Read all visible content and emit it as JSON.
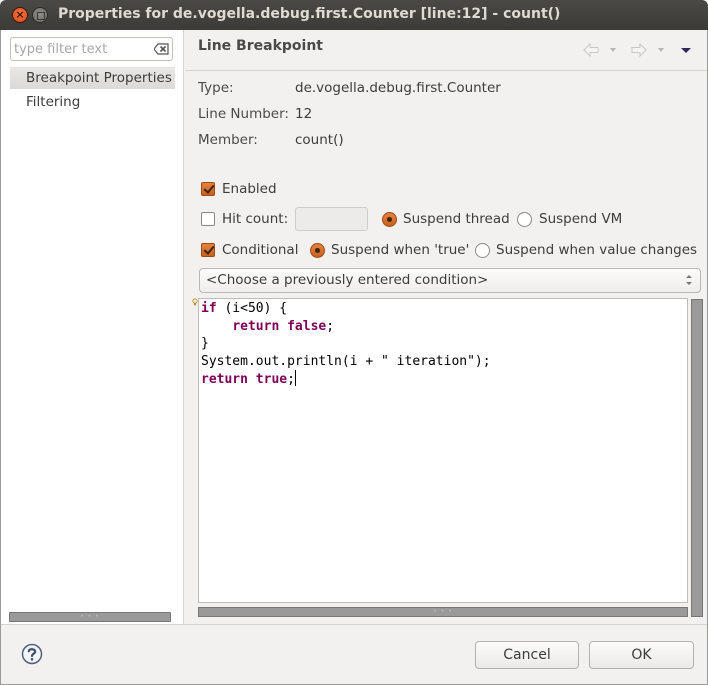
{
  "window": {
    "title": "Properties for de.vogella.debug.first.Counter [line:12] - count()"
  },
  "sidebar": {
    "filter_placeholder": "type filter text",
    "items": [
      {
        "label": "Breakpoint Properties",
        "selected": true
      },
      {
        "label": "Filtering",
        "selected": false
      }
    ]
  },
  "page": {
    "title": "Line Breakpoint",
    "nav": [
      "back-icon",
      "back-menu-icon",
      "forward-icon",
      "forward-menu-icon",
      "view-menu-icon"
    ],
    "properties": [
      {
        "label": "Type:",
        "value": "de.vogella.debug.first.Counter"
      },
      {
        "label": "Line Number:",
        "value": "12"
      },
      {
        "label": "Member:",
        "value": "count()"
      }
    ],
    "enabled": {
      "label": "Enabled",
      "checked": true
    },
    "hit_count": {
      "label": "Hit count:",
      "checked": false,
      "value": ""
    },
    "suspend_thread": {
      "label": "Suspend thread",
      "selected": true
    },
    "suspend_vm": {
      "label": "Suspend VM",
      "selected": false
    },
    "conditional": {
      "label": "Conditional",
      "checked": true
    },
    "suspend_when_true": {
      "label": "Suspend when 'true'",
      "selected": true
    },
    "suspend_when_changes": {
      "label": "Suspend when value changes",
      "selected": false
    },
    "condition_history": {
      "selected": "<Choose a previously entered condition>"
    },
    "condition_code": [
      [
        {
          "t": "if",
          "kw": true
        },
        {
          "t": " (i<50) {",
          "kw": false
        }
      ],
      [
        {
          "t": "    ",
          "kw": false
        },
        {
          "t": "return false",
          "kw": true
        },
        {
          "t": ";",
          "kw": false
        }
      ],
      [
        {
          "t": "}",
          "kw": false
        }
      ],
      [
        {
          "t": "System.out.println(i + \" iteration\");",
          "kw": false
        }
      ],
      [
        {
          "t": "return true",
          "kw": true
        },
        {
          "t": ";",
          "kw": false
        }
      ]
    ]
  },
  "footer": {
    "cancel_label": "Cancel",
    "ok_label": "OK"
  },
  "colors": {
    "accent": "#dd4814",
    "keyword": "#7f0055",
    "titlebar": "#3c3b37"
  }
}
